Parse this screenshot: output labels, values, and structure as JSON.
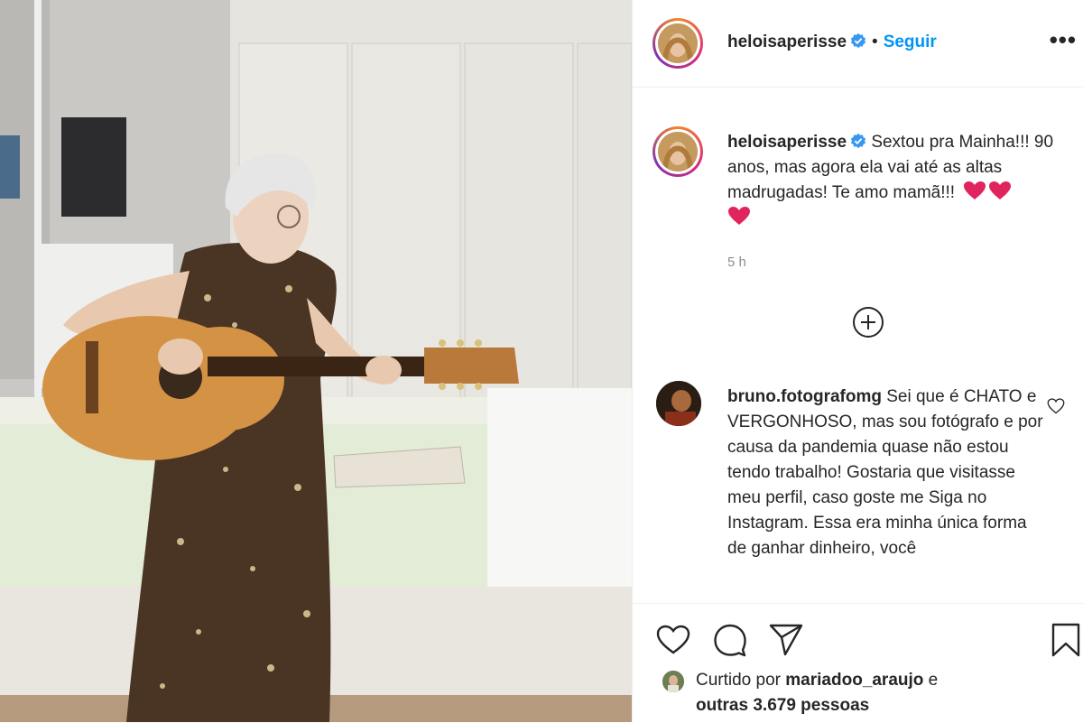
{
  "post": {
    "author": "heloisaperisse",
    "follow_label": "Seguir",
    "dot": "•",
    "more": "•••",
    "caption": "Sextou pra Mainha!!! 90 anos, mas agora ela vai até as altas madrugadas! Te amo mamã!!!",
    "time": "5 h"
  },
  "comments": [
    {
      "user": "bruno.fotografomg",
      "text": "Sei que é CHATO e VERGONHOSO, mas sou fotógrafo e por causa da pandemia quase não estou tendo trabalho! Gostaria que visitasse meu perfil, caso goste me Siga no Instagram. Essa era minha única forma de ganhar dinheiro, você"
    }
  ],
  "likes": {
    "prefix": "Curtido por",
    "user": "mariadoo_araujo",
    "conj": "e",
    "others": "outras 3.679 pessoas"
  },
  "icons": {
    "like": "heart-icon",
    "comment": "comment-icon",
    "share": "paper-plane-icon",
    "save": "bookmark-icon",
    "add": "plus-circle-icon",
    "verified": "verified-badge-icon",
    "caption_hearts": "red-heart-emoji"
  },
  "colors": {
    "link": "#0095f6",
    "verified": "#3897f0",
    "heart_emoji": "#e0245e",
    "muted": "#8e8e8e"
  }
}
